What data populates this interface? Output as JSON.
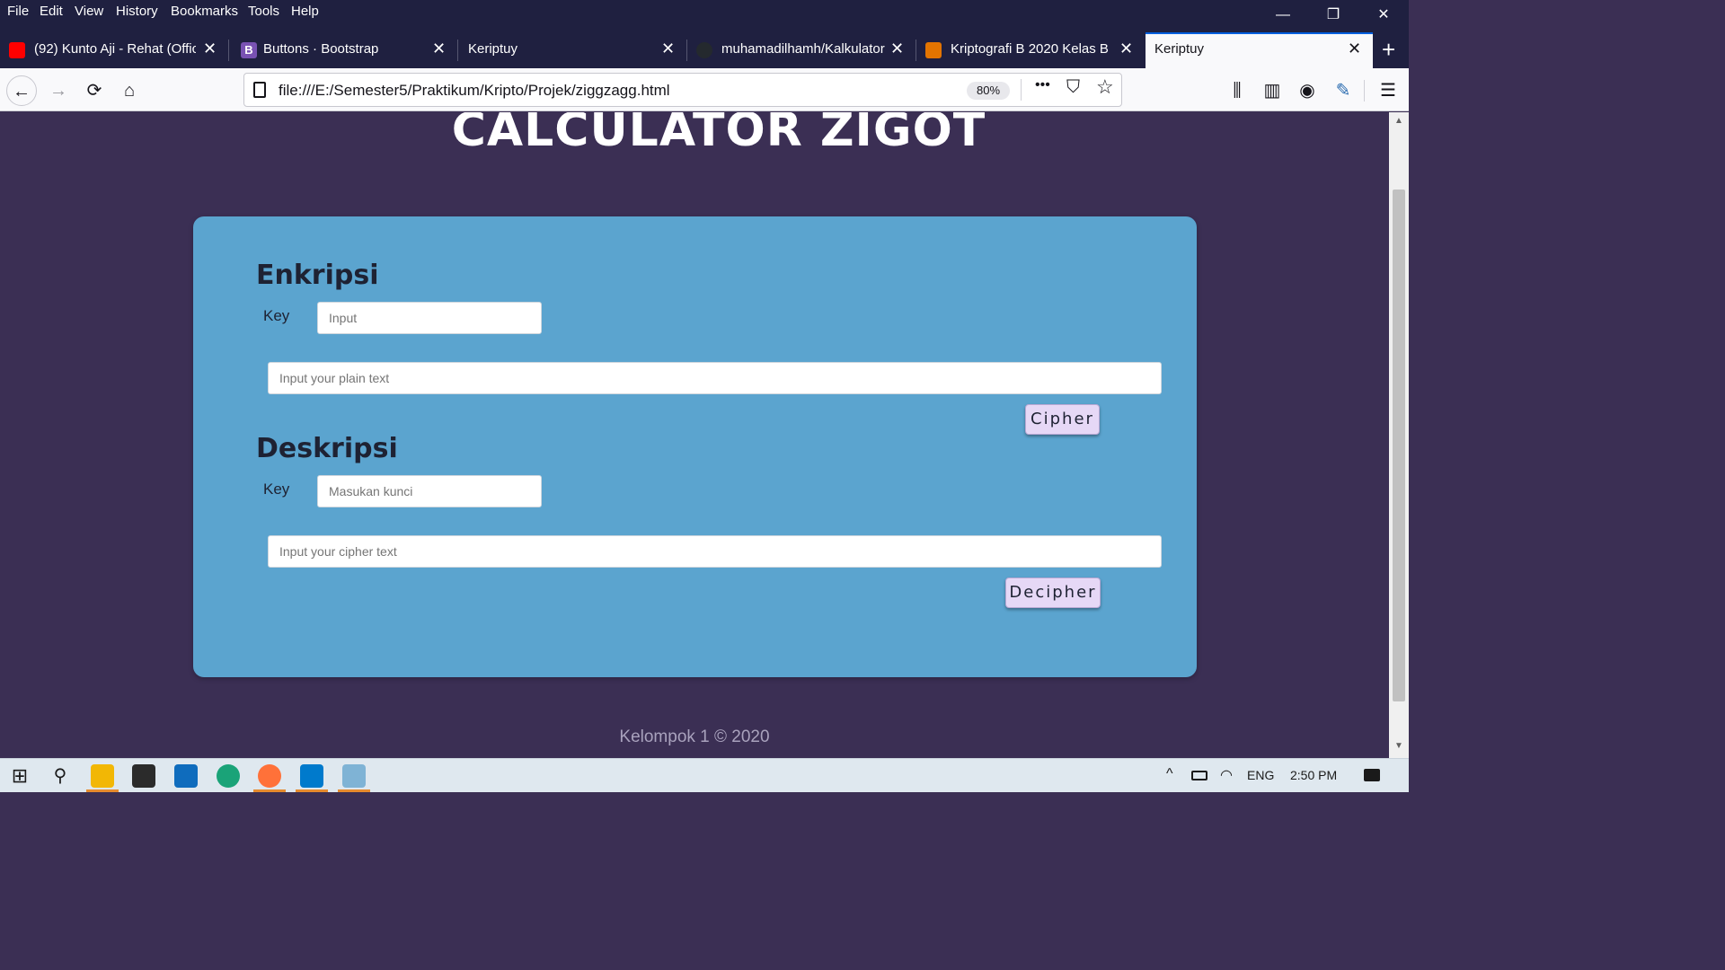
{
  "menu": [
    "File",
    "Edit",
    "View",
    "History",
    "Bookmarks",
    "Tools",
    "Help"
  ],
  "window_controls": {
    "minimize": "—",
    "restore": "❐",
    "close": "✕"
  },
  "tabs": [
    {
      "label": "(92) Kunto Aji - Rehat (Offici",
      "favicon_color": "#ff0000",
      "favicon": "youtube-icon"
    },
    {
      "label": "Buttons · Bootstrap",
      "favicon_color": "#7952b3",
      "favicon": "bootstrap-icon"
    },
    {
      "label": "Keriptuy",
      "favicon_color": "",
      "favicon": ""
    },
    {
      "label": "muhamadilhamh/Kalkulator",
      "favicon_color": "#24292e",
      "favicon": "github-icon"
    },
    {
      "label": "Kriptografi B 2020 Kelas B",
      "favicon_color": "#e37400",
      "favicon": "classroom-icon"
    },
    {
      "label": "Keriptuy",
      "favicon_color": "",
      "favicon": ""
    }
  ],
  "new_tab_symbol": "+",
  "close_symbol": "✕",
  "nav": {
    "back": "←",
    "forward": "→",
    "reload": "⟳",
    "home": "⌂",
    "more": "•••",
    "pocket": "⛉",
    "star": "☆",
    "library": "⫼",
    "sidebar": "▥",
    "account": "◉",
    "extension": "✎",
    "menu": "☰"
  },
  "address": {
    "url": "file:///E:/Semester5/Praktikum/Kripto/Projek/ziggzagg.html",
    "zoom": "80%"
  },
  "page": {
    "title": "CALCULATOR ZIGOT",
    "encrypt": {
      "heading": "Enkripsi",
      "key_label": "Key",
      "key_placeholder": "Input",
      "text_placeholder": "Input your plain text",
      "button": "Cipher"
    },
    "decrypt": {
      "heading": "Deskripsi",
      "key_label": "Key",
      "key_placeholder": "Masukan kunci",
      "text_placeholder": "Input your cipher text",
      "button": "Decipher"
    },
    "footer": "Kelompok 1 © 2020"
  },
  "taskbar": {
    "apps": [
      "windows-start-icon",
      "search-icon",
      "file-explorer-icon",
      "store-icon",
      "mail-icon",
      "edge-icon",
      "firefox-icon",
      "vscode-icon",
      "notepad-icon"
    ],
    "tray": {
      "chevron": "^",
      "language": "ENG",
      "time": "2:50 PM"
    }
  }
}
